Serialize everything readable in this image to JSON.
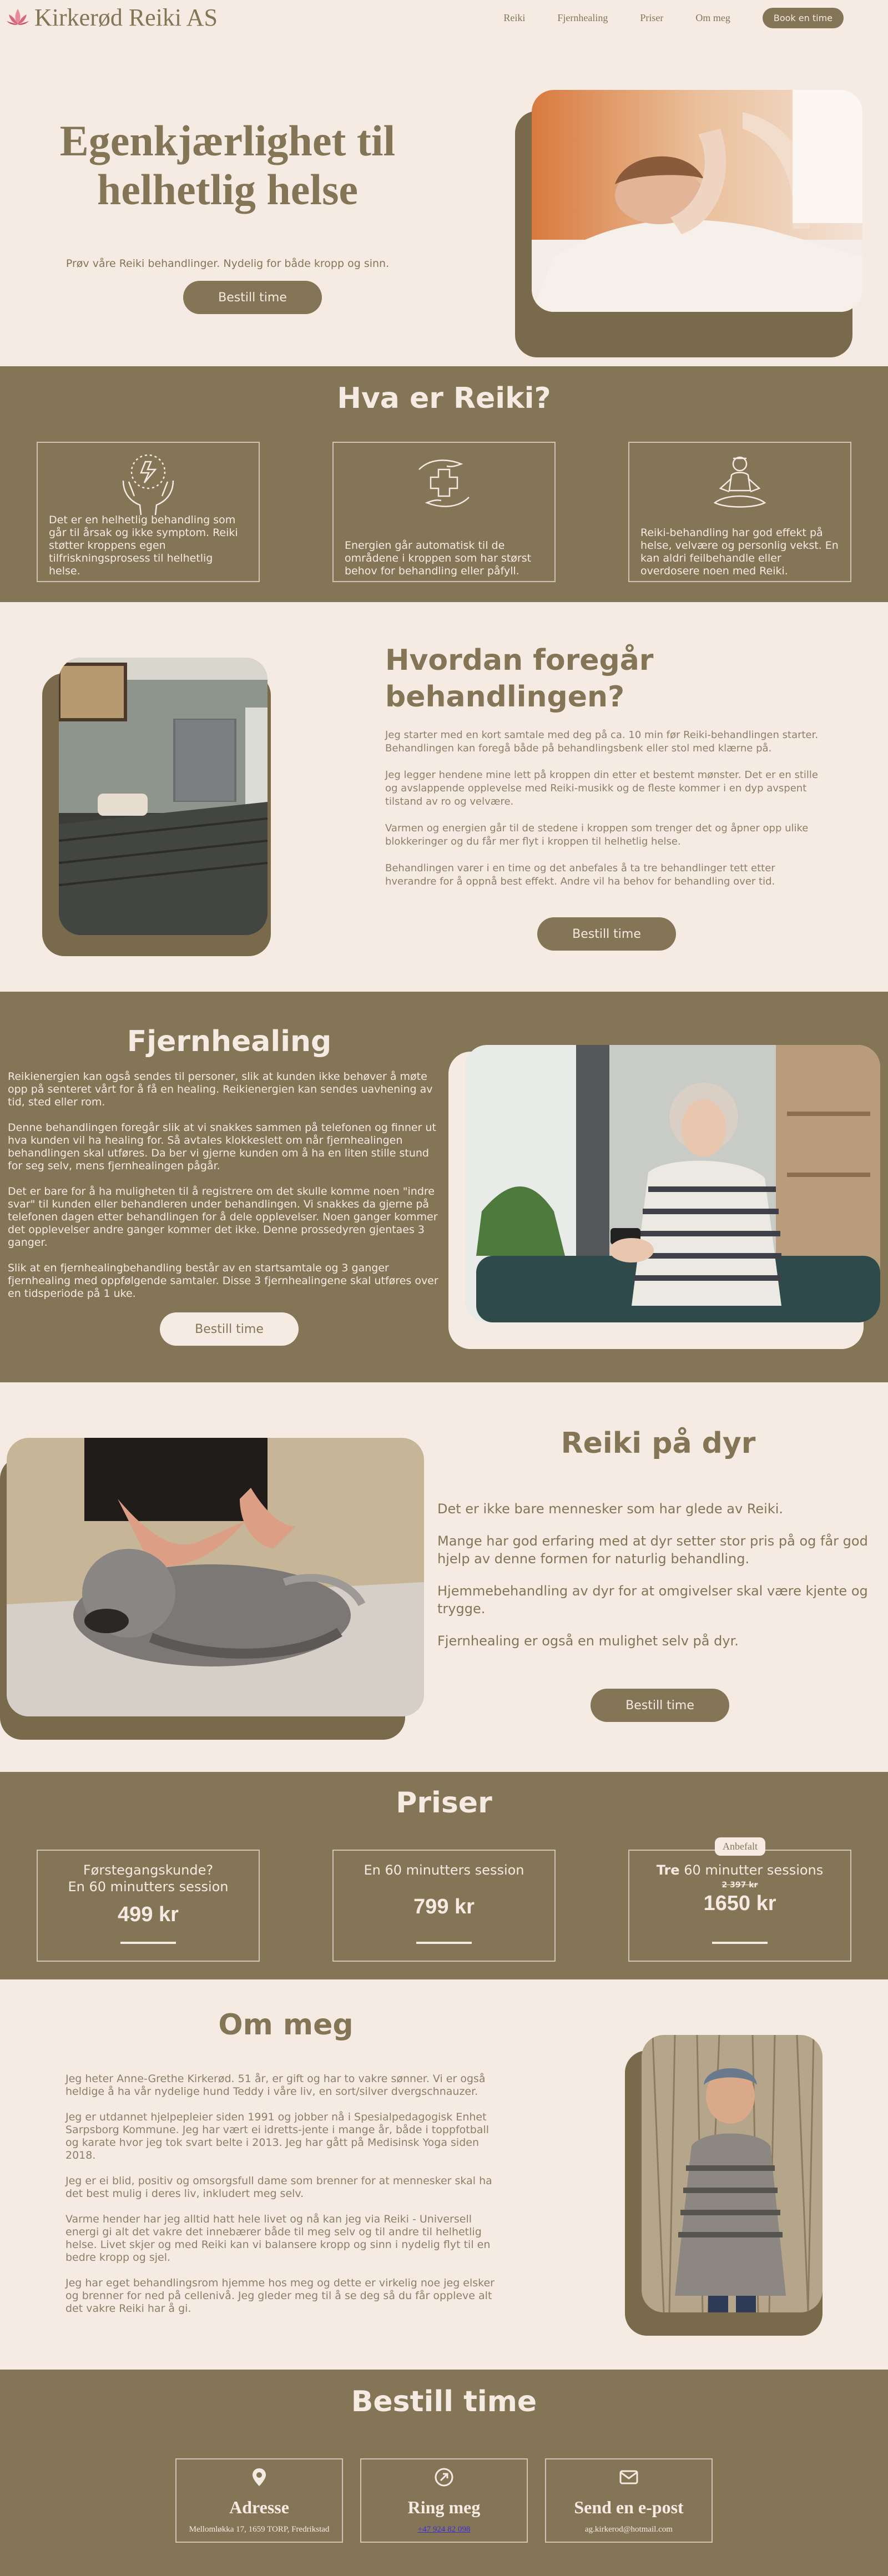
{
  "nav": {
    "logo": "Kirkerød Reiki AS",
    "items": [
      "Reiki",
      "Fjernhealing",
      "Priser",
      "Om meg"
    ],
    "book": "Book en time"
  },
  "hero": {
    "title": "Egenkjærlighet til helhetlig helse",
    "subtitle": "Prøv våre Reiki behandlinger. Nydelig for både kropp og sinn.",
    "cta": "Bestill time"
  },
  "reiki": {
    "title": "Hva er Reiki?",
    "cards": [
      {
        "icon": "healing-hands-icon",
        "text": "Det er en helhetlig behandling som går til årsak og ikke symptom. Reiki støtter kroppens egen tilfriskningsprosess til helhetlig helse."
      },
      {
        "icon": "hands-cross-icon",
        "text": "Energien går automatisk til de områdene i kroppen som har størst behov for behandling eller påfyll."
      },
      {
        "icon": "meditation-icon",
        "text": "Reiki-behandling har god effekt på helse, velvære og personlig vekst. En kan aldri feilbehandle eller overdosere noen med Reiki."
      }
    ]
  },
  "how": {
    "title": "Hvordan foregår behandlingen?",
    "paragraphs": [
      "Jeg starter med en kort samtale med deg på ca. 10 min før Reiki-behandlingen starter. Behandlingen kan foregå både på behandlingsbenk eller stol med klærne på.",
      "Jeg legger hendene mine lett på kroppen din etter et bestemt mønster. Det er en stille og avslappende opplevelse med Reiki-musikk og de fleste kommer i en dyp avspent tilstand av ro og velvære.",
      "Varmen og energien går til de stedene i kroppen som trenger det og åpner opp ulike blokkeringer og du får mer flyt i kroppen til helhetlig helse.",
      "Behandlingen varer i en time og det anbefales å ta tre behandlinger tett etter hverandre for å oppnå best effekt. Andre vil ha behov for behandling over tid."
    ],
    "cta": "Bestill time"
  },
  "fjern": {
    "title": "Fjernhealing",
    "paragraphs": [
      "Reikienergien kan også sendes til personer, slik at kunden ikke behøver å møte opp på senteret vårt for å få en healing. Reikienergien kan sendes uavhening av tid, sted eller rom.",
      "Denne behandlingen foregår slik at vi snakkes sammen på telefonen og finner ut hva kunden vil ha healing for. Så avtales klokkeslett om når fjernhealingen behandlingen skal utføres. Da ber vi gjerne kunden om å ha en liten stille stund for seg selv, mens fjernhealingen pågår.",
      "Det er bare for å ha muligheten til å registrere om det skulle komme noen \"indre svar\" til kunden eller behandleren under behandlingen. Vi snakkes da gjerne på telefonen dagen etter behandlingen for å dele opplevelser. Noen ganger kommer det opplevelser andre ganger kommer det ikke. Denne prossedyren gjentaes 3 ganger.",
      "Slik at en fjernhealingbehandling består av en startsamtale og 3 ganger fjernhealing med oppfølgende samtaler. Disse 3 fjernhealingene skal utføres over en tidsperiode på 1 uke."
    ],
    "cta": "Bestill time"
  },
  "dyr": {
    "title": "Reiki på dyr",
    "paragraphs": [
      "Det er ikke bare mennesker som har glede av Reiki.",
      "Mange har god erfaring med at dyr setter stor pris på og får god hjelp av denne formen for naturlig behandling.",
      "Hjemmebehandling av dyr for at omgivelser skal være kjente og trygge.",
      "Fjernhealing er også en mulighet selv på dyr."
    ],
    "cta": "Bestill time"
  },
  "priser": {
    "title": "Priser",
    "cards": [
      {
        "line1": "Førstegangskunde?",
        "line2": "En 60 minutters session",
        "price": "499 kr"
      },
      {
        "line1": "En 60 minutters session",
        "line2": "",
        "price": "799 kr"
      },
      {
        "badge": "Anbefalt",
        "bold": "Tre",
        "line1": " 60 minutter sessions",
        "old": "2 397 kr",
        "price": "1650 kr"
      }
    ]
  },
  "om": {
    "title": "Om meg",
    "paragraphs": [
      "Jeg heter Anne-Grethe Kirkerød. 51 år, er gift og har to vakre sønner. Vi er også heldige å ha vår nydelige hund Teddy i våre liv, en sort/silver dvergschnauzer.",
      "Jeg er utdannet hjelpepleier siden 1991 og jobber nå i Spesialpedagogisk Enhet Sarpsborg Kommune. Jeg har vært ei idretts-jente i mange år, både i toppfotball og karate hvor jeg tok svart belte i 2013. Jeg har gått på Medisinsk Yoga siden 2018.",
      "Jeg er ei blid, positiv og omsorgsfull dame som brenner for at mennesker skal ha det best mulig i deres liv, inkludert meg selv.",
      "Varme hender har jeg alltid hatt hele livet og nå kan jeg via Reiki - Universell energi gi alt det vakre det innebærer både til meg selv og til andre til helhetlig helse. Livet skjer og med Reiki kan vi balansere kropp og sinn i nydelig flyt til en bedre kropp og sjel.",
      "Jeg har eget behandlingsrom hjemme hos meg og dette er virkelig noe jeg elsker og brenner for ned på cellenivå. Jeg gleder meg til å se deg så du får oppleve alt det vakre Reiki har å gi."
    ]
  },
  "bestill": {
    "title": "Bestill time",
    "cards": [
      {
        "icon": "location-pin-icon",
        "head": "Adresse",
        "value": "Mellomløkka 17, 1659 TORP, Fredrikstad"
      },
      {
        "icon": "phone-icon",
        "head": "Ring meg",
        "value": "+47 924 82 098"
      },
      {
        "icon": "envelope-icon",
        "head": "Send en e-post",
        "value": "ag.kirkerod@hotmail.com"
      }
    ]
  }
}
